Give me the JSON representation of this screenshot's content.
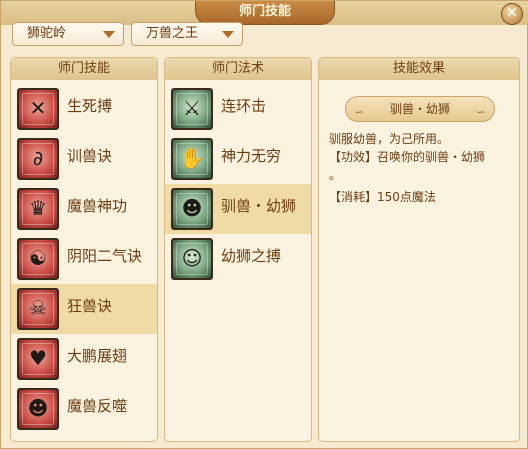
{
  "window": {
    "title": "师门技能"
  },
  "selectors": {
    "school": "狮驼岭",
    "faction": "万兽之王"
  },
  "panels": {
    "skills": {
      "header": "师门技能",
      "items": [
        {
          "label": "生死搏",
          "icon": "crossed-weapons-icon"
        },
        {
          "label": "训兽诀",
          "icon": "whip-icon"
        },
        {
          "label": "魔兽神功",
          "icon": "demon-face-icon"
        },
        {
          "label": "阴阳二气诀",
          "icon": "yin-yang-mask-icon"
        },
        {
          "label": "狂兽诀",
          "icon": "beast-skull-icon"
        },
        {
          "label": "大鹏展翅",
          "icon": "wings-icon"
        },
        {
          "label": "魔兽反噬",
          "icon": "beast-bite-icon"
        }
      ],
      "selected_index": 4
    },
    "spells": {
      "header": "师门法术",
      "items": [
        {
          "label": "连环击",
          "icon": "chain-strike-icon"
        },
        {
          "label": "神力无穷",
          "icon": "power-icon"
        },
        {
          "label": "驯兽・幼狮",
          "icon": "lion-cub-icon"
        },
        {
          "label": "幼狮之搏",
          "icon": "lion-fight-icon"
        }
      ],
      "selected_index": 2
    },
    "effect": {
      "header": "技能效果",
      "title": "驯兽・幼狮",
      "line1": "驯服幼兽，为己所用。",
      "line2_prefix": "【功效】",
      "line2_text": "召唤你的驯兽・幼狮",
      "line3": "。",
      "line4_prefix": "【消耗】",
      "line4_text": "150点魔法"
    }
  },
  "colors": {
    "text_brown": "#6b3d12",
    "accent": "#d8561a",
    "selected_row": "#f0dba6"
  }
}
